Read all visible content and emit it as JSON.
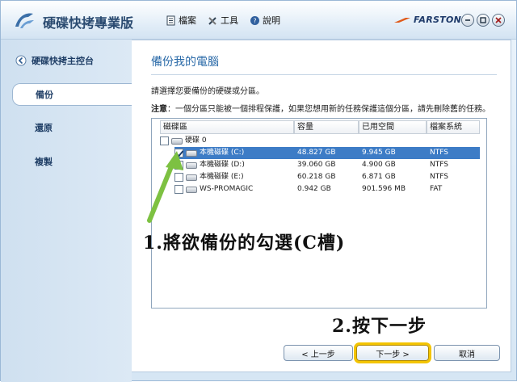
{
  "app": {
    "title": "硬碟快拷專業版",
    "brand": "FARSTONE"
  },
  "menu": [
    {
      "label": "檔案",
      "icon": "file-icon"
    },
    {
      "label": "工具",
      "icon": "tools-icon"
    },
    {
      "label": "說明",
      "icon": "help-icon"
    }
  ],
  "sidebar": {
    "home": "硬碟快拷主控台",
    "items": [
      {
        "label": "備份",
        "active": true
      },
      {
        "label": "還原",
        "active": false
      },
      {
        "label": "複製",
        "active": false
      }
    ]
  },
  "panel": {
    "title": "備份我的電腦",
    "instruction": "請選擇您要備份的硬碟或分區。",
    "note_label": "注意",
    "note_text": "：一個分區只能被一個排程保護，如果您想用新的任務保護這個分區，請先刪除舊的任務。"
  },
  "table": {
    "columns": [
      "磁碟區",
      "容量",
      "已用空間",
      "檔案系統"
    ],
    "disk_label": "硬碟 0",
    "rows": [
      {
        "name": "本機磁碟 (C:)",
        "capacity": "48.827 GB",
        "used": "9.945 GB",
        "fs": "NTFS",
        "checked": true,
        "selected": true
      },
      {
        "name": "本機磁碟 (D:)",
        "capacity": "39.060 GB",
        "used": "4.900 GB",
        "fs": "NTFS",
        "checked": false,
        "selected": false
      },
      {
        "name": "本機磁碟 (E:)",
        "capacity": "60.218 GB",
        "used": "6.871 GB",
        "fs": "NTFS",
        "checked": false,
        "selected": false
      },
      {
        "name": "WS-PROMAGIC",
        "capacity": "0.942 GB",
        "used": "901.596 MB",
        "fs": "FAT",
        "checked": false,
        "selected": false
      }
    ]
  },
  "annotations": {
    "step1": "1.將欲備份的勾選(C槽)",
    "step2": "2.按下一步",
    "arrow_color": "#7dc142",
    "highlight_color": "#f3c400"
  },
  "buttons": {
    "back": "< 上一步",
    "next": "下一步 >",
    "cancel": "取消"
  }
}
